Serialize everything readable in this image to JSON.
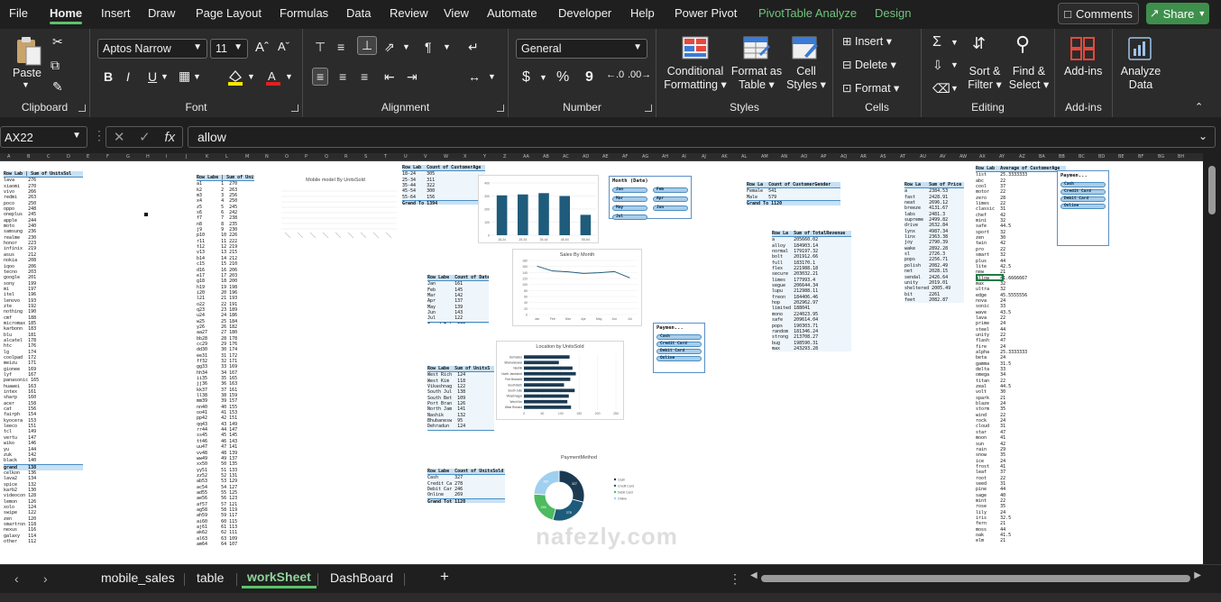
{
  "ribbon_tabs": [
    "File",
    "Home",
    "Insert",
    "Draw",
    "Page Layout",
    "Formulas",
    "Data",
    "Review",
    "View",
    "Automate",
    "Developer",
    "Help",
    "Power Pivot",
    "PivotTable Analyze",
    "Design"
  ],
  "active_tab": "Home",
  "buttons": {
    "comments": "Comments",
    "share": "Share"
  },
  "clipboard": {
    "paste": "Paste",
    "label": "Clipboard"
  },
  "font": {
    "name": "Aptos Narrow",
    "size": "11",
    "label": "Font",
    "bold": "B",
    "italic": "I",
    "underline": "U"
  },
  "alignment": {
    "label": "Alignment"
  },
  "number": {
    "format": "General",
    "label": "Number",
    "currency": "$",
    "percent": "%",
    "comma": "9"
  },
  "styles": {
    "conditional": "Conditional",
    "formatting": "Formatting",
    "format_as": "Format as",
    "table": "Table",
    "cell": "Cell",
    "styles_btn": "Styles",
    "label": "Styles"
  },
  "cells": {
    "insert": "Insert",
    "delete": "Delete",
    "format": "Format",
    "label": "Cells"
  },
  "editing": {
    "sort": "Sort &",
    "filter": "Filter",
    "find": "Find &",
    "select": "Select",
    "label": "Editing"
  },
  "addins": {
    "addins": "Add-ins",
    "label": "Add-ins"
  },
  "analyze": {
    "analyze": "Analyze",
    "data": "Data"
  },
  "formula_bar": {
    "name_box": "AX22",
    "formula": "allow",
    "fx": "fx"
  },
  "charts": {
    "models_title": "Mobile model By UnitsSold",
    "sales_title": "Sales By Month",
    "location_title": "Location by UnitsSold",
    "payment_title": "PaymentMethod"
  },
  "chart_data": [
    {
      "type": "bar",
      "title": "",
      "categories": [
        "18-24",
        "25-34",
        "35-44",
        "45-54",
        "55-64"
      ],
      "values": [
        305,
        312,
        322,
        300,
        156
      ],
      "ylim": [
        0,
        400
      ]
    },
    {
      "type": "line",
      "title": "Sales By Month",
      "categories": [
        "Jan",
        "Feb",
        "Mar",
        "Apr",
        "May",
        "Jun",
        "Jul"
      ],
      "values": [
        161,
        145,
        142,
        137,
        139,
        143,
        122
      ],
      "ylim": [
        0,
        180
      ]
    },
    {
      "type": "bar",
      "title": "Location by UnitsSold",
      "categories": [
        "Dehradun",
        "Bhubaneswar",
        "Nashik",
        "North Jamesfort",
        "Port Brandon",
        "South Beth",
        "South Julie",
        "Vikashnagar",
        "West Kim",
        "West Richard"
      ],
      "values": [
        124,
        95,
        132,
        141,
        126,
        109,
        138,
        122,
        118,
        128
      ],
      "orientation": "horizontal",
      "xlim": [
        0,
        250
      ]
    },
    {
      "type": "pie",
      "title": "PaymentMethod",
      "categories": [
        "Cash",
        "Credit Card",
        "Debit Card",
        "Online"
      ],
      "values": [
        327,
        278,
        246,
        269
      ]
    }
  ],
  "slicers": {
    "month": {
      "title": "Month (Date)",
      "items": [
        "Jan",
        "Feb",
        "Mar",
        "Apr",
        "May",
        "Jun",
        "Jul"
      ]
    },
    "payment1": {
      "title": "Paymen...",
      "items": [
        "Cash",
        "Credit Card",
        "Debit Card",
        "Online"
      ]
    },
    "payment2": {
      "title": "Paymen...",
      "items": [
        "Cash",
        "Credit Card",
        "Debit Card",
        "Online"
      ]
    }
  },
  "pivot_tables": {
    "p1": "Row Lab | Sum of UnitsSol\nlava     276\nxiaomi   270\nvivo     266\nredmi    263\npoco     250\noppo     248\noneplus  245\napple    244\nmoto     240\nsamsung  236\nrealme   230\nhonor    223\ninfinix  219\nasus     212\nnokia    208\niqoo     206\ntecno    203\ngoogle   201\nsony     199\nmi       197\nitel     196\nlenovo   193\nzte      192\nnothing  190\ncmf      188\nmicromax 185\nkarbonn  183\nblu      181\nalcatel  178\nhtc      176\nlg       174\ncoolpad  172\nmeizu    171\ngionee   169\nlyf      167\npanasonic 165\nhuawei   163\nintex    161\nsharp    160\nacer     158\ncat      156\nfairph   154\nkyocera  153\nleeco    151\ntcl      149\nvertu    147\nwiko     146\nyu       144\nzuk      142\nblack    140\ngrand    138\ncelkon   136\nlava2    134\nspice    132\nkarb2    130\nvideocon 128\nlemon    126\nxolo     124\nswipe    122\nzen      120\nsmartron 118\nnexus    116\ngalaxy   114\nother    112",
    "p2": "Row Labe | Sum of UnitsSol\na1       1  270\nk2       2  263\nm3       3  256\nx4       4  250\nz5       5  245\ns6       6  242\nf7       7  238\nn8       8  235\nj9       9  230\np10      10 226\nr11      11 222\nt12      12 219\nv13      13 215\nb14      14 212\nc15      15 210\nd16      16 206\ne17      17 203\ng18      18 200\nh19      19 198\ni20      20 196\nl21      21 193\no22      22 191\nq23      23 189\nu24      24 186\nw25      25 184\ny26      26 182\naa27     27 180\nbb28     28 178\ncc29     29 176\ndd30     30 174\nee31     31 172\nff32     32 171\ngg33     33 169\nhh34     34 167\nii35     35 165\njj36     36 163\nkk37     37 161\nll38     38 159\nmm39     39 157\nnn40     40 155\noo41     41 153\npp42     42 151\nqq43     43 149\nrr44     44 147\nss45     45 145\ntt46     46 143\nuu47     47 141\nvv48     48 139\nww49     49 137\nxx50     50 135\nyy51     51 133\nzz52     52 131\nab53     53 129\nac54     54 127\nad55     55 125\nae56     56 123\naf57     57 121\nag58     58 119\nah59     59 117\nai60     60 115\naj61     61 113\nak62     62 111\nal63     63 109\nam64     64 107",
    "p3": "Row Lab  Count of CustomerAge\n18-24    305\n25-34    311\n35-44    322\n45-54    300\n55-64    156\nGrand To 1394",
    "p4": "Row Labe  Count of Date (Mont\nJan       161\nFeb       145\nMar       142\nApr       137\nMay       139\nJun       143\nJul       122\nGrand Tota 989",
    "p5": "Row Labe  Sum of UnitsS\nWest Rich  124\nWest Kim   118\nVikashnag  122\nSouth Jul  138\nSouth Bet  109\nPort Bran  126\nNorth Jam  141\nNashik     132\nBhubanesw  95\nDehradun   124\nGrand Tota 1229",
    "p6": "Row Labe  Count of UnitsSold\nCash      327\nCredit Ca 278\nDebit Car 246\nOnline    269\nGrand Tot 1120",
    "p7": "Row La  Count of CustomerGender\nFemale  541\nMale    579\nGrand To 1120",
    "p8": "Row La  Sum of TotalRevenue\na       205660.02\nalloy   184903.14\nnormal  179197.32\nbolt    201912.66\nfull    183170.1\nflex    221988.18\nsecure  203032.21\nlimes   177993.4\nsegue   206644.34\nlupu    212988.11\nfreon   184406.46\nhop     202962.97\nlimited 188041\nmono    224023.95\nsafe    209614.04\npops    190303.71\nrandom  181346.24\nstrong  213708.27\nbug     198590.31\nmax     243293.28\nGrand To 4,044,801",
    "p9": "Row La   Sum of Price\na        2384.53\nfast     2428.91\nneat     2696.12\nbreeze   4131.67\nlabs     2481.3\nsupreme  2499.82\ndrive    2632.84\nlynx     4987.34\nlinx     2363.38\njoy      2790.39\nwake     2892.28\nsl       2726.3\npops     2256.71\npolish   2082.49\nnet      2028.15\nsendal   2426.64\nunity    2019.01\nsheltered 2005.49\nbit      2261\nfeet     2082.87\nGrand To 55555",
    "p10": "Row Lab  Average of CustomerAge\nlist     25.3333333\nabc      22\ncool     37\nmotor    22\nzero     28\nlimes    22\nclassic  31\nchef     42\nmini     32\nsafe     44.5\nsport    32\nzen      30\ntwin     42\npro      22\nsmart    32\nplus     44\nlite     42.5\nnew      21\nallow    41.6666667\nmax      32\nultra    32\nedge     45.5555556\nnova     24\nsonic    33\nwave     43.5\nlava     22\nprime    24\nsteel    44\nunity    22\nflash    47\nfire     24\nalpha    25.3333333\nbeta     24\ngamma    31.5\ndelta    33\nomega    34\ntitan    22\nzeal     44.5\nvolt     30\nspark    21\nblaze    24\nstorm    35\nwind     22\nrock     24\ncloud    31\nstar     47\nmoon     41\nsun      42\nrain     29\nsnow     35\nice      24\nfrost    41\nleaf     37\nroot     22\nseed     31\npine     44\nsage     40\nmint     22\nrose     35\nlily     24\niris     32.5\nfern     21\nmoss     44\noak      41.5\nelm      21"
  }
}
